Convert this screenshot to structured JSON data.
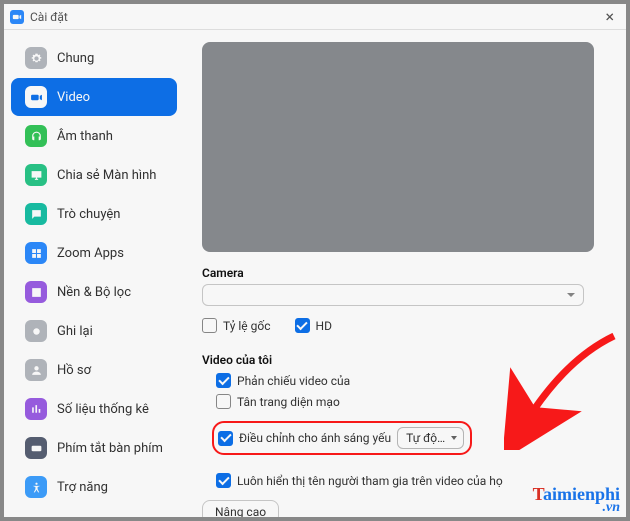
{
  "window": {
    "title": "Cài đặt",
    "close": "×"
  },
  "sidebar": {
    "items": [
      {
        "label": "Chung"
      },
      {
        "label": "Video"
      },
      {
        "label": "Âm thanh"
      },
      {
        "label": "Chia sẻ Màn hình"
      },
      {
        "label": "Trò chuyện"
      },
      {
        "label": "Zoom Apps"
      },
      {
        "label": "Nền & Bộ lọc"
      },
      {
        "label": "Ghi lại"
      },
      {
        "label": "Hồ sơ"
      },
      {
        "label": "Số liệu thống kê"
      },
      {
        "label": "Phím tắt bàn phím"
      },
      {
        "label": "Trợ năng"
      }
    ]
  },
  "content": {
    "camera_label": "Camera",
    "camera_value": "",
    "aspect_label": "Tỷ lệ gốc",
    "hd_label": "HD",
    "my_video_label": "Video của tôi",
    "mirror_label": "Phản chiếu video của",
    "touchup_label": "Tân trang diện mạo",
    "lowlight_label": "Điều chỉnh cho ánh sáng yếu",
    "lowlight_mode": "Tự độ…",
    "always_names_label": "Luôn hiển thị tên người tham gia trên video của họ",
    "advanced_label": "Nâng cao"
  },
  "watermark": {
    "line1_a": "T",
    "line1_b": "aimienphi",
    "line2": ".vn"
  }
}
